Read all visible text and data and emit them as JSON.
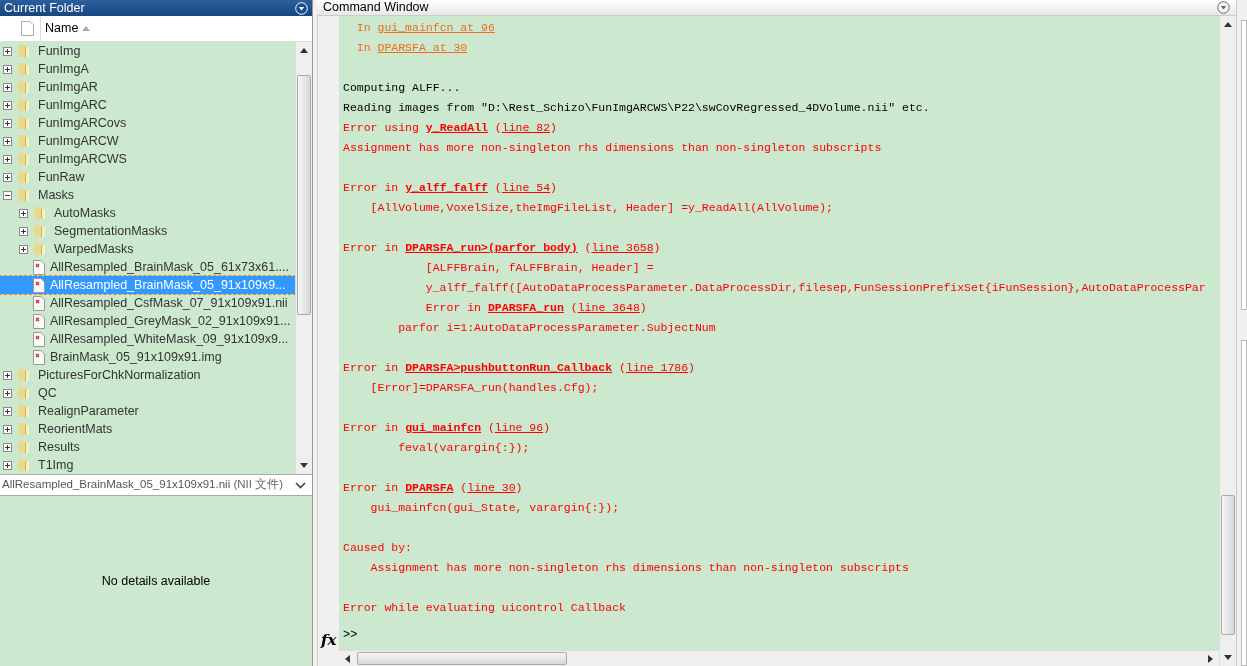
{
  "current_folder": {
    "title": "Current Folder",
    "column": "Name",
    "tree": [
      {
        "kind": "folder",
        "name": "FunImg",
        "expanded": false,
        "selected": false
      },
      {
        "kind": "folder",
        "name": "FunImgA",
        "expanded": false,
        "selected": false
      },
      {
        "kind": "folder",
        "name": "FunImgAR",
        "expanded": false,
        "selected": false
      },
      {
        "kind": "folder",
        "name": "FunImgARC",
        "expanded": false,
        "selected": false
      },
      {
        "kind": "folder",
        "name": "FunImgARCovs",
        "expanded": false,
        "selected": false
      },
      {
        "kind": "folder",
        "name": "FunImgARCW",
        "expanded": false,
        "selected": false
      },
      {
        "kind": "folder",
        "name": "FunImgARCWS",
        "expanded": false,
        "selected": false
      },
      {
        "kind": "folder",
        "name": "FunRaw",
        "expanded": false,
        "selected": false
      },
      {
        "kind": "folder",
        "name": "Masks",
        "expanded": true,
        "selected": false,
        "children": [
          {
            "kind": "folder",
            "name": "AutoMasks",
            "expanded": false,
            "selected": false
          },
          {
            "kind": "folder",
            "name": "SegmentationMasks",
            "expanded": false,
            "selected": false
          },
          {
            "kind": "folder",
            "name": "WarpedMasks",
            "expanded": false,
            "selected": false
          },
          {
            "kind": "file",
            "name": "AllResampled_BrainMask_05_61x73x61....",
            "selected": false
          },
          {
            "kind": "file",
            "name": "AllResampled_BrainMask_05_91x109x9...",
            "selected": true
          },
          {
            "kind": "file",
            "name": "AllResampled_CsfMask_07_91x109x91.nii",
            "selected": false
          },
          {
            "kind": "file",
            "name": "AllResampled_GreyMask_02_91x109x91...",
            "selected": false
          },
          {
            "kind": "file",
            "name": "AllResampled_WhiteMask_09_91x109x9...",
            "selected": false
          },
          {
            "kind": "file",
            "name": "BrainMask_05_91x109x91.img",
            "selected": false
          }
        ]
      },
      {
        "kind": "folder",
        "name": "PicturesForChkNormalization",
        "expanded": false,
        "selected": false
      },
      {
        "kind": "folder",
        "name": "QC",
        "expanded": false,
        "selected": false
      },
      {
        "kind": "folder",
        "name": "RealignParameter",
        "expanded": false,
        "selected": false
      },
      {
        "kind": "folder",
        "name": "ReorientMats",
        "expanded": false,
        "selected": false
      },
      {
        "kind": "folder",
        "name": "Results",
        "expanded": false,
        "selected": false
      },
      {
        "kind": "folder",
        "name": "T1Img",
        "expanded": false,
        "selected": false
      }
    ],
    "details": {
      "file": "AllResampled_BrainMask_05_91x109x91.nii",
      "type": "(NII 文件)",
      "message": "No details available"
    }
  },
  "command_window": {
    "title": "Command Window",
    "function_button": "fx",
    "prompt": ">>",
    "lines": [
      {
        "kind": "warning",
        "parts": [
          {
            "kind": "text",
            "text": "  In "
          },
          {
            "kind": "ref",
            "text": "gui_mainfcn at 96"
          }
        ]
      },
      {
        "kind": "warning",
        "parts": [
          {
            "kind": "text",
            "text": "  In "
          },
          {
            "kind": "ref",
            "text": "DPARSFA at 30"
          }
        ]
      },
      {
        "kind": "blank"
      },
      {
        "kind": "output",
        "parts": [
          {
            "kind": "text",
            "text": "Computing ALFF..."
          }
        ]
      },
      {
        "kind": "output",
        "parts": [
          {
            "kind": "text",
            "text": "Reading images from \"D:\\Rest_Schizo\\FunImgARCWS\\P22\\swCovRegressed_4DVolume.nii\" etc."
          }
        ]
      },
      {
        "kind": "error",
        "parts": [
          {
            "kind": "text",
            "text": "Error using "
          },
          {
            "kind": "link",
            "text": "y_ReadAll"
          },
          {
            "kind": "text",
            "text": " ("
          },
          {
            "kind": "ref",
            "text": "line 82"
          },
          {
            "kind": "text",
            "text": ")"
          }
        ]
      },
      {
        "kind": "error",
        "parts": [
          {
            "kind": "text",
            "text": "Assignment has more non-singleton rhs dimensions than non-singleton subscripts"
          }
        ]
      },
      {
        "kind": "blank"
      },
      {
        "kind": "error",
        "parts": [
          {
            "kind": "text",
            "text": "Error in "
          },
          {
            "kind": "link",
            "text": "y_alff_falff"
          },
          {
            "kind": "text",
            "text": " ("
          },
          {
            "kind": "ref",
            "text": "line 54"
          },
          {
            "kind": "text",
            "text": ")"
          }
        ]
      },
      {
        "kind": "error",
        "parts": [
          {
            "kind": "text",
            "text": "    [AllVolume,VoxelSize,theImgFileList, Header] =y_ReadAll(AllVolume);"
          }
        ]
      },
      {
        "kind": "blank"
      },
      {
        "kind": "error",
        "parts": [
          {
            "kind": "text",
            "text": "Error in "
          },
          {
            "kind": "link",
            "text": "DPARSFA_run>(parfor body)"
          },
          {
            "kind": "text",
            "text": " ("
          },
          {
            "kind": "ref",
            "text": "line 3658"
          },
          {
            "kind": "text",
            "text": ")"
          }
        ]
      },
      {
        "kind": "error",
        "parts": [
          {
            "kind": "text",
            "text": "            [ALFFBrain, fALFFBrain, Header] ="
          }
        ]
      },
      {
        "kind": "error",
        "parts": [
          {
            "kind": "text",
            "text": "            y_alff_falff([AutoDataProcessParameter.DataProcessDir,filesep,FunSessionPrefixSet{iFunSession},AutoDataProcessPar"
          }
        ]
      },
      {
        "kind": "error",
        "parts": [
          {
            "kind": "text",
            "text": "            Error in "
          },
          {
            "kind": "link",
            "text": "DPARSFA_run"
          },
          {
            "kind": "text",
            "text": " ("
          },
          {
            "kind": "ref",
            "text": "line 3648"
          },
          {
            "kind": "text",
            "text": ")"
          }
        ]
      },
      {
        "kind": "error",
        "parts": [
          {
            "kind": "text",
            "text": "        parfor i=1:AutoDataProcessParameter.SubjectNum"
          }
        ]
      },
      {
        "kind": "blank"
      },
      {
        "kind": "error",
        "parts": [
          {
            "kind": "text",
            "text": "Error in "
          },
          {
            "kind": "link",
            "text": "DPARSFA>pushbuttonRun_Callback"
          },
          {
            "kind": "text",
            "text": " ("
          },
          {
            "kind": "ref",
            "text": "line 1786"
          },
          {
            "kind": "text",
            "text": ")"
          }
        ]
      },
      {
        "kind": "error",
        "parts": [
          {
            "kind": "text",
            "text": "    [Error]=DPARSFA_run(handles.Cfg);"
          }
        ]
      },
      {
        "kind": "blank"
      },
      {
        "kind": "error",
        "parts": [
          {
            "kind": "text",
            "text": "Error in "
          },
          {
            "kind": "link",
            "text": "gui_mainfcn"
          },
          {
            "kind": "text",
            "text": " ("
          },
          {
            "kind": "ref",
            "text": "line 96"
          },
          {
            "kind": "text",
            "text": ")"
          }
        ]
      },
      {
        "kind": "error",
        "parts": [
          {
            "kind": "text",
            "text": "        feval(varargin{:});"
          }
        ]
      },
      {
        "kind": "blank"
      },
      {
        "kind": "error",
        "parts": [
          {
            "kind": "text",
            "text": "Error in "
          },
          {
            "kind": "link",
            "text": "DPARSFA"
          },
          {
            "kind": "text",
            "text": " ("
          },
          {
            "kind": "ref",
            "text": "line 30"
          },
          {
            "kind": "text",
            "text": ")"
          }
        ]
      },
      {
        "kind": "error",
        "parts": [
          {
            "kind": "text",
            "text": "    gui_mainfcn(gui_State, varargin{:});"
          }
        ]
      },
      {
        "kind": "blank"
      },
      {
        "kind": "error",
        "parts": [
          {
            "kind": "text",
            "text": "Caused by:"
          }
        ]
      },
      {
        "kind": "error",
        "parts": [
          {
            "kind": "text",
            "text": "    Assignment has more non-singleton rhs dimensions than non-singleton subscripts"
          }
        ]
      },
      {
        "kind": "blank"
      },
      {
        "kind": "error",
        "parts": [
          {
            "kind": "text",
            "text": "Error while evaluating uicontrol Callback"
          }
        ]
      }
    ]
  }
}
